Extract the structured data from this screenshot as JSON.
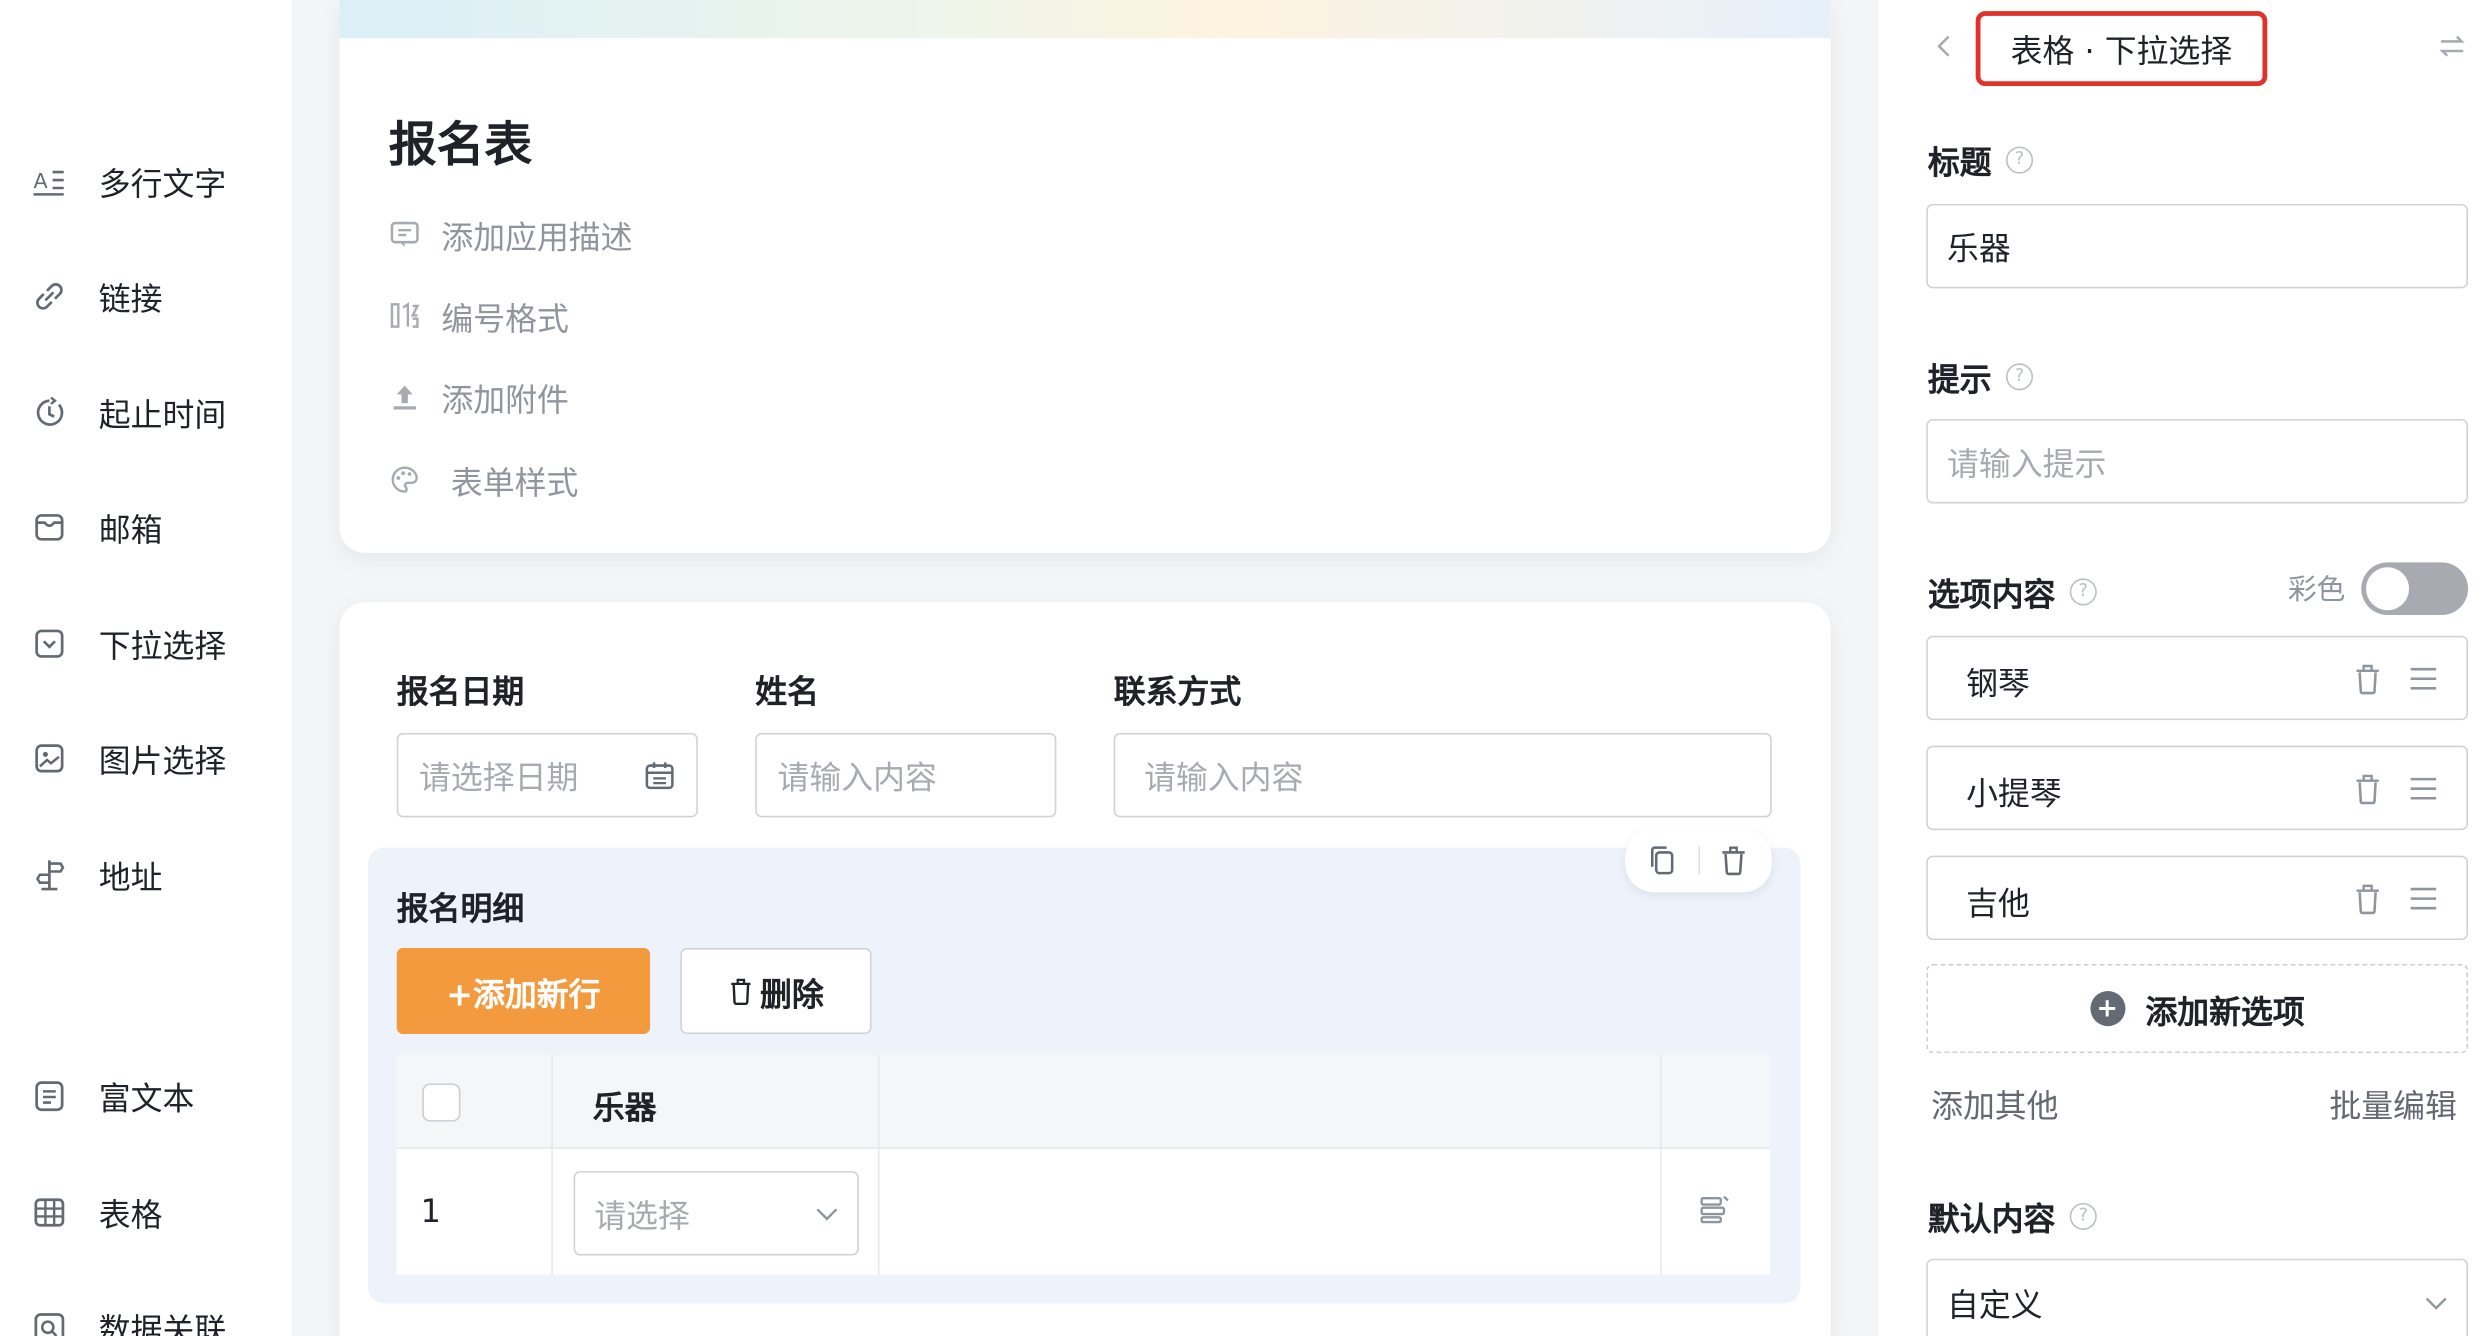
{
  "sidebar": {
    "items": [
      {
        "label": "多行文字",
        "icon": "multiline-text-icon"
      },
      {
        "label": "链接",
        "icon": "link-icon"
      },
      {
        "label": "起止时间",
        "icon": "time-range-icon"
      },
      {
        "label": "邮箱",
        "icon": "mailbox-icon"
      },
      {
        "label": "下拉选择",
        "icon": "dropdown-icon"
      },
      {
        "label": "图片选择",
        "icon": "image-icon"
      },
      {
        "label": "地址",
        "icon": "address-icon"
      },
      {
        "label": "富文本",
        "icon": "rich-text-icon"
      },
      {
        "label": "表格",
        "icon": "table-icon"
      },
      {
        "label": "数据关联",
        "icon": "data-link-icon"
      }
    ]
  },
  "form": {
    "title": "报名表",
    "meta": [
      {
        "label": "添加应用描述",
        "icon": "comment-icon"
      },
      {
        "label": "编号格式",
        "icon": "number-format-icon"
      },
      {
        "label": "添加附件",
        "icon": "upload-icon"
      },
      {
        "label": "表单样式",
        "icon": "palette-icon"
      }
    ],
    "fields": [
      {
        "label": "报名日期",
        "placeholder": "请选择日期"
      },
      {
        "label": "姓名",
        "placeholder": "请输入内容"
      },
      {
        "label": "联系方式",
        "placeholder": "请输入内容"
      }
    ],
    "subtable": {
      "title": "报名明细",
      "add_row": "+添加新行",
      "delete": "删除",
      "column": "乐器",
      "row_number": "1",
      "select_placeholder": "请选择"
    }
  },
  "panel": {
    "header": "表格 · 下拉选择",
    "title_label": "标题",
    "title_value": "乐器",
    "hint_label": "提示",
    "hint_placeholder": "请输入提示",
    "options_label": "选项内容",
    "color_label": "彩色",
    "color_enabled": false,
    "options": [
      "钢琴",
      "小提琴",
      "吉他"
    ],
    "add_option": "添加新选项",
    "add_other": "添加其他",
    "batch_edit": "批量编辑",
    "default_label": "默认内容",
    "default_value": "自定义",
    "help_glyph": "?",
    "accent": "#f39a3e",
    "highlight": "#e0312a"
  }
}
